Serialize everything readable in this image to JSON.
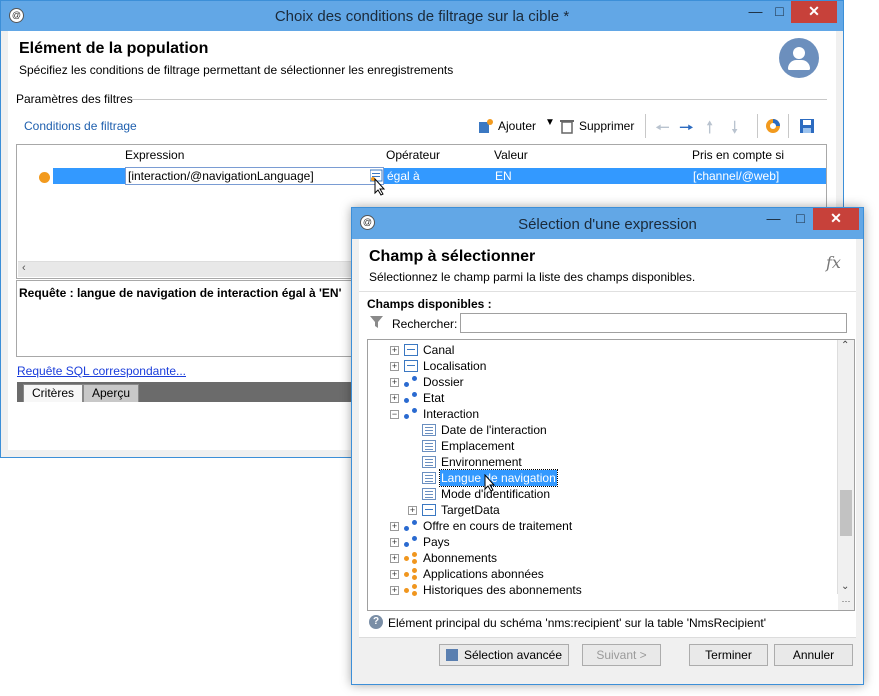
{
  "main_window": {
    "title": "Choix des conditions de filtrage sur la cible *",
    "header_title": "Elément de la population",
    "header_subtitle": "Spécifiez les conditions de filtrage permettant de sélectionner les enregistrements",
    "section_label": "Paramètres des filtres",
    "toolbar_title": "Conditions de filtrage",
    "add_label": "Ajouter",
    "delete_label": "Supprimer",
    "columns": [
      "Expression",
      "Opérateur",
      "Valeur",
      "Pris en compte si"
    ],
    "row": {
      "expression": "[interaction/@navigationLanguage]",
      "operator": "égal à",
      "value": "EN",
      "condition": "[channel/@web]"
    },
    "query_text": "Requête : langue de navigation de interaction égal à 'EN'",
    "sql_link": "Requête SQL correspondante...",
    "tabs": [
      "Critères",
      "Aperçu"
    ]
  },
  "dialog": {
    "title": "Sélection d'une expression",
    "header_title": "Champ à sélectionner",
    "header_subtitle": "Sélectionnez le champ parmi la liste des champs disponibles.",
    "fx_label": "fx",
    "available_label": "Champs disponibles :",
    "search_label": "Rechercher:",
    "search_value": "",
    "tree": [
      {
        "label": "Canal",
        "icon": "field-icon",
        "expander": "+",
        "level": 0
      },
      {
        "label": "Localisation",
        "icon": "field-icon",
        "expander": "+",
        "level": 0
      },
      {
        "label": "Dossier",
        "icon": "link-icon",
        "expander": "+",
        "level": 0
      },
      {
        "label": "Etat",
        "icon": "link-icon",
        "expander": "+",
        "level": 0
      },
      {
        "label": "Interaction",
        "icon": "link-icon",
        "expander": "−",
        "level": 0
      },
      {
        "label": "Date de l'interaction",
        "icon": "list-icon",
        "expander": "",
        "level": 1
      },
      {
        "label": "Emplacement",
        "icon": "list-icon",
        "expander": "",
        "level": 1
      },
      {
        "label": "Environnement",
        "icon": "list-icon",
        "expander": "",
        "level": 1
      },
      {
        "label": "Langue de navigation",
        "icon": "list-icon",
        "expander": "",
        "level": 1,
        "selected": true
      },
      {
        "label": "Mode d'identification",
        "icon": "list-icon",
        "expander": "",
        "level": 1
      },
      {
        "label": "TargetData",
        "icon": "field-icon",
        "expander": "+",
        "level": 1
      },
      {
        "label": "Offre en cours de traitement",
        "icon": "link-icon",
        "expander": "+",
        "level": 0
      },
      {
        "label": "Pays",
        "icon": "link-icon",
        "expander": "+",
        "level": 0
      },
      {
        "label": "Abonnements",
        "icon": "collection-icon",
        "expander": "+",
        "level": 0
      },
      {
        "label": "Applications abonnées",
        "icon": "collection-icon",
        "expander": "+",
        "level": 0
      },
      {
        "label": "Historiques des abonnements",
        "icon": "collection-icon",
        "expander": "+",
        "level": 0
      }
    ],
    "info_text": "Elément principal du schéma 'nms:recipient' sur la table 'NmsRecipient'",
    "buttons": {
      "advanced": "Sélection avancée",
      "next": "Suivant >",
      "finish": "Terminer",
      "cancel": "Annuler"
    }
  },
  "colors": {
    "title_bar": "#62a7e6",
    "selection": "#3399ff",
    "close_button": "#c7413a"
  }
}
